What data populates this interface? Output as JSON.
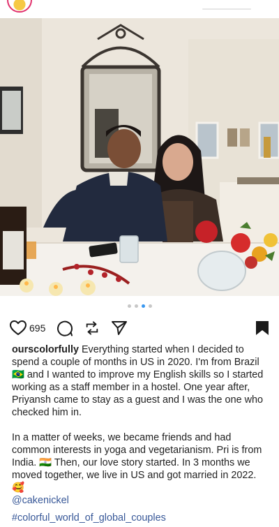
{
  "post": {
    "likes": "695",
    "username": "ourscolorfully",
    "caption_p1_a": " Everything started when I decided to spend a couple of months in US in 2020. I'm from Brazil ",
    "flag_brazil": "🇧🇷",
    "caption_p1_b": " and I wanted to improve my English skills so I started working as a staff member in a hostel. One year after, Priyansh came to stay as a guest and I was the one who checked him in.",
    "caption_p2_a": "In a matter of weeks, we became friends and had common interests in yoga and vegetarianism. Pri is from India. ",
    "flag_india": "🇮🇳",
    "caption_p2_b": " Then, our love story started. In 3 months we moved together, we live in US and got married in 2022. ",
    "emoji_love": "🥰",
    "mention": "@cakenickel",
    "hashtag": "#colorful_world_of_global_couples"
  },
  "carousel": {
    "count": 4,
    "active_index": 2
  },
  "icons": {
    "like": "heart-icon",
    "comment": "comment-bubble-icon",
    "share": "repost-icon",
    "send": "send-paper-plane-icon",
    "save": "bookmark-icon"
  },
  "colors": {
    "accent_link": "#385898",
    "active_dot": "#3897f0",
    "text": "#1a1a1a"
  }
}
